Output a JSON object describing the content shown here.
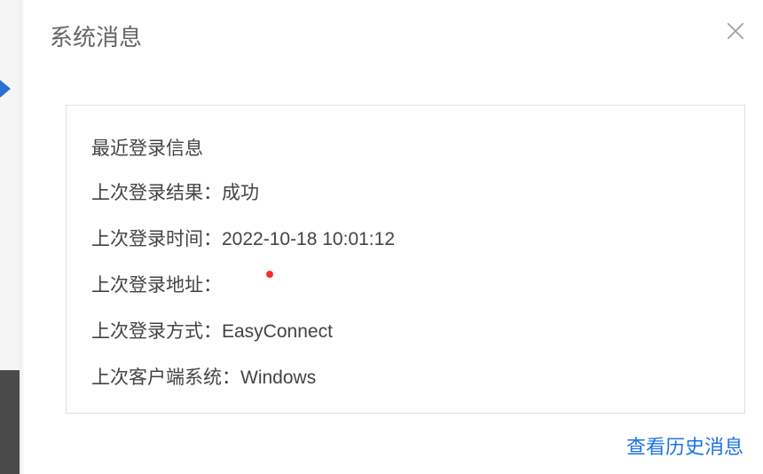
{
  "dialog": {
    "title": "系统消息"
  },
  "panel": {
    "heading": "最近登录信息",
    "rows": {
      "result": {
        "label": "上次登录结果：",
        "value": "成功"
      },
      "time": {
        "label": "上次登录时间：",
        "value": "2022-10-18 10:01:12"
      },
      "addr": {
        "label": "上次登录地址：",
        "value": ""
      },
      "method": {
        "label": "上次登录方式：",
        "value": "EasyConnect"
      },
      "os": {
        "label": "上次客户端系统：",
        "value": "Windows"
      }
    }
  },
  "footer": {
    "history_link": "查看历史消息"
  }
}
